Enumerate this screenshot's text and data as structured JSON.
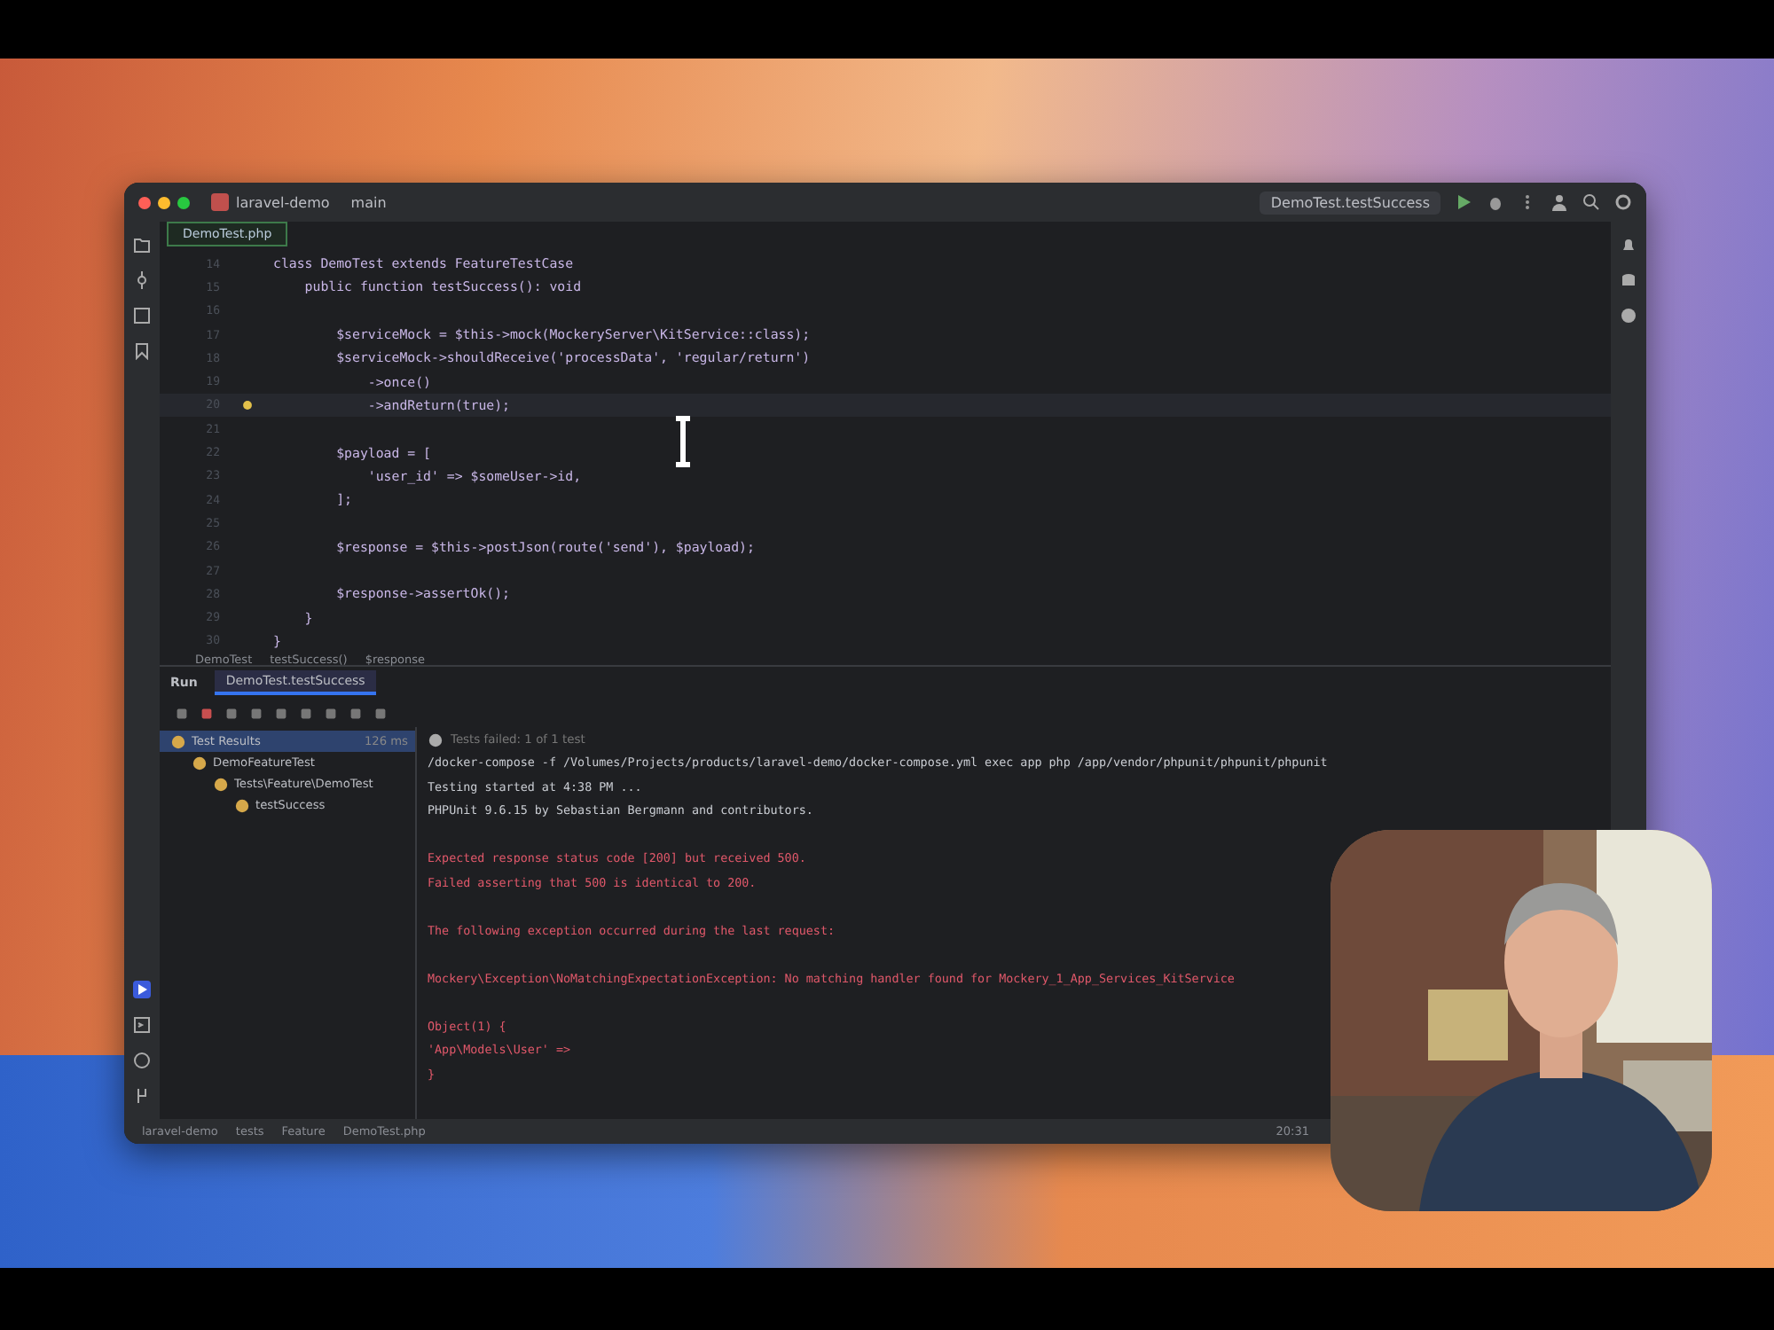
{
  "titlebar": {
    "project": "laravel-demo",
    "branch": "main",
    "run_config": "DemoTest.testSuccess"
  },
  "editor_tab": {
    "label": "DemoTest.php",
    "selected": true
  },
  "code_lines": [
    {
      "number": "14",
      "text": "class DemoTest extends FeatureTestCase",
      "current": false
    },
    {
      "number": "15",
      "text": "    public function testSuccess(): void",
      "current": false
    },
    {
      "number": "16",
      "current": false
    },
    {
      "number": "17",
      "text": "        $serviceMock = $this->mock(MockeryServer\\KitService::class);",
      "current": false
    },
    {
      "number": "18",
      "text": "        $serviceMock->shouldReceive('processData', 'regular/return')",
      "current": false
    },
    {
      "number": "19",
      "text": "            ->once()",
      "current": false
    },
    {
      "number": "20",
      "text": "            ->andReturn(true);",
      "current": true
    },
    {
      "number": "21",
      "current": false
    },
    {
      "number": "22",
      "text": "        $payload = [",
      "current": false
    },
    {
      "number": "23",
      "text": "            'user_id' => $someUser->id,",
      "current": false
    },
    {
      "number": "24",
      "text": "        ];",
      "current": false
    },
    {
      "number": "25",
      "current": false
    },
    {
      "number": "26",
      "text": "        $response = $this->postJson(route('send'), $payload);",
      "current": false
    },
    {
      "number": "27",
      "current": false
    },
    {
      "number": "28",
      "text": "        $response->assertOk();",
      "current": false
    },
    {
      "number": "29",
      "text": "    }",
      "current": false
    },
    {
      "number": "30",
      "text": "}",
      "current": false
    }
  ],
  "breadcrumbs": [
    "DemoTest",
    "testSuccess()",
    "$response"
  ],
  "run_panel": {
    "label": "Run",
    "tab": {
      "label": "DemoTest.testSuccess",
      "selected": true
    }
  },
  "test_tree": [
    {
      "label": "Test Results",
      "time": "126 ms",
      "children": [
        {
          "label": "DemoFeatureTest",
          "children": [
            {
              "label": "Tests\\Feature\\DemoTest",
              "children": [
                {
                  "label": "testSuccess"
                }
              ]
            }
          ]
        }
      ]
    }
  ],
  "console_header": "Tests failed: 1 of 1 test",
  "console_lines": [
    {
      "kind": "plain",
      "text": "/docker-compose -f /Volumes/Projects/products/laravel-demo/docker-compose.yml exec app php /app/vendor/phpunit/phpunit/phpunit"
    },
    {
      "kind": "plain",
      "text": "Testing started at 4:38 PM ..."
    },
    {
      "kind": "plain",
      "text": "PHPUnit 9.6.15 by Sebastian Bergmann and contributors."
    },
    {
      "kind": "blank"
    },
    {
      "kind": "error",
      "text": "Expected response status code [200] but received 500."
    },
    {
      "kind": "error",
      "text": "Failed asserting that 500 is identical to 200."
    },
    {
      "kind": "blank"
    },
    {
      "kind": "error",
      "text": "The following exception occurred during the last request:"
    },
    {
      "kind": "blank"
    },
    {
      "kind": "error",
      "text": "Mockery\\Exception\\NoMatchingExpectationException: No matching handler found for Mockery_1_App_Services_KitService"
    },
    {
      "kind": "blank"
    },
    {
      "kind": "error",
      "text": "Object(1) {"
    },
    {
      "kind": "error",
      "text": "  'App\\Models\\User' =>"
    },
    {
      "kind": "error",
      "text": "  }"
    }
  ],
  "status_bar": {
    "path": [
      "laravel-demo",
      "tests",
      "Feature",
      "DemoTest.php"
    ],
    "position": "20:31"
  }
}
